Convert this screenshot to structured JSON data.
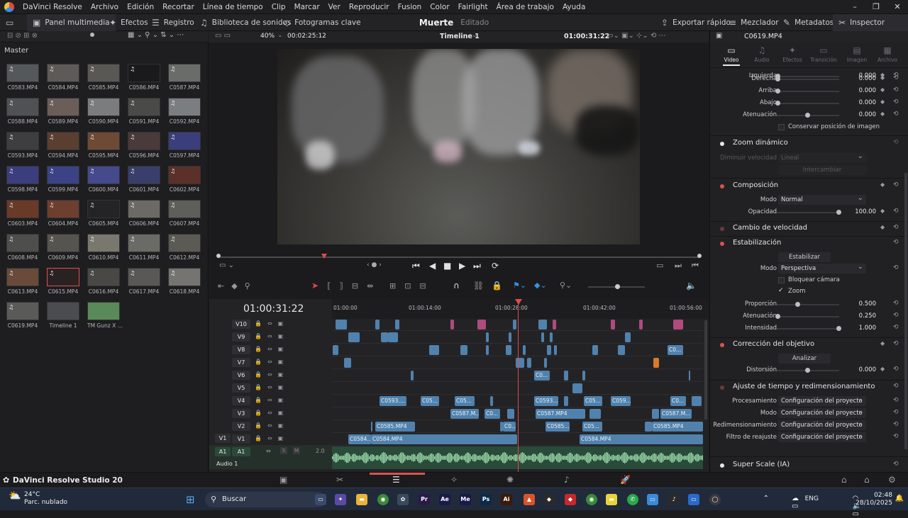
{
  "app": {
    "title": "DaVinci Resolve",
    "menus": [
      "Archivo",
      "Edición",
      "Recortar",
      "Línea de tiempo",
      "Clip",
      "Marcar",
      "Ver",
      "Reproducir",
      "Fusion",
      "Color",
      "Fairlight",
      "Área de trabajo",
      "Ayuda"
    ]
  },
  "toolbar": {
    "media_pool": "Panel multimedia",
    "effects": "Efectos",
    "index": "Registro",
    "sound_library": "Biblioteca de sonidos",
    "keyframes": "Fotogramas clave",
    "project_name": "Muerte",
    "project_status": "Editado",
    "quick_export": "Exportar rápido",
    "mixer": "Mezclador",
    "metadata": "Metadatos",
    "inspector": "Inspector"
  },
  "pool": {
    "folder": "Master",
    "clips": [
      {
        "name": "C0583.MP4",
        "color": "#55585a"
      },
      {
        "name": "C0584.MP4",
        "color": "#5d5a58"
      },
      {
        "name": "C0585.MP4",
        "color": "#5a5855"
      },
      {
        "name": "C0586.MP4",
        "color": "#1a1a1c"
      },
      {
        "name": "C0587.MP4",
        "color": "#6a6c6a"
      },
      {
        "name": "C0588.MP4",
        "color": "#4f5155"
      },
      {
        "name": "C0589.MP4",
        "color": "#6b5e58"
      },
      {
        "name": "C0590.MP4",
        "color": "#7a7c7e"
      },
      {
        "name": "C0591.MP4",
        "color": "#4a4a48"
      },
      {
        "name": "C0592.MP4",
        "color": "#7b7e80"
      },
      {
        "name": "C0593.MP4",
        "color": "#3e3e40"
      },
      {
        "name": "C0594.MP4",
        "color": "#5a3e30"
      },
      {
        "name": "C0595.MP4",
        "color": "#6e4a36"
      },
      {
        "name": "C0596.MP4",
        "color": "#4a3a3a"
      },
      {
        "name": "C0597.MP4",
        "color": "#3a3e7a"
      },
      {
        "name": "C0598.MP4",
        "color": "#3a3e7e"
      },
      {
        "name": "C0599.MP4",
        "color": "#3c4286"
      },
      {
        "name": "C0600.MP4",
        "color": "#444a8c"
      },
      {
        "name": "C0601.MP4",
        "color": "#3a3e6c"
      },
      {
        "name": "C0602.MP4",
        "color": "#5a3028"
      },
      {
        "name": "C0603.MP4",
        "color": "#6a3a28"
      },
      {
        "name": "C0604.MP4",
        "color": "#6e3e2e"
      },
      {
        "name": "C0605.MP4",
        "color": "#242426"
      },
      {
        "name": "C0606.MP4",
        "color": "#6c6a64"
      },
      {
        "name": "C0607.MP4",
        "color": "#5e5e5a"
      },
      {
        "name": "C0608.MP4",
        "color": "#4e4e4c"
      },
      {
        "name": "C0609.MP4",
        "color": "#56544e"
      },
      {
        "name": "C0610.MP4",
        "color": "#7a786e"
      },
      {
        "name": "C0611.MP4",
        "color": "#6a6a66"
      },
      {
        "name": "C0612.MP4",
        "color": "#5c5a54"
      },
      {
        "name": "C0613.MP4",
        "color": "#6a4a3a"
      },
      {
        "name": "C0615.MP4",
        "color": "#2a2222",
        "selected": true
      },
      {
        "name": "C0616.MP4",
        "color": "#4a4844"
      },
      {
        "name": "C0617.MP4",
        "color": "#5a5856"
      },
      {
        "name": "C0618.MP4",
        "color": "#767470"
      },
      {
        "name": "C0619.MP4",
        "color": "#5a5a58"
      },
      {
        "name": "Timeline 1",
        "color": "#4a4c50"
      },
      {
        "name": "TM Gunz X ...",
        "color": "#5a8a5a"
      }
    ]
  },
  "viewer": {
    "zoom": "40%",
    "source_tc": "00:02:25:12",
    "timeline_name": "Timeline 1",
    "record_tc": "01:00:31:22",
    "scrub_fraction": 0.22
  },
  "timeline": {
    "timecode": "01:00:31:22",
    "ruler": [
      "01:00:00",
      "01:00:14:00",
      "01:00:28:00",
      "01:00:42:00",
      "01:00:56:00"
    ],
    "video_tracks": [
      "V10",
      "V9",
      "V8",
      "V7",
      "V6",
      "V5",
      "V4",
      "V3",
      "V2",
      "V1"
    ],
    "patch_video": "V1",
    "audio_track": "A1",
    "patch_audio": "A1",
    "audio_channels": "2.0",
    "audio_name": "Audio 1",
    "audio_solo": "S",
    "audio_mute": "M",
    "clip_labels": {
      "v8": "C0...",
      "v6": "C0...",
      "v4a": "C0593....",
      "v4b": "C05...",
      "v4c": "C05...",
      "v4d": "C0593....",
      "v4e": "C05...",
      "v4f": "C059...",
      "v4g": "C0...",
      "v3a": "C0587.M...",
      "v3b": "C0...",
      "v3c": "C0587.MP4",
      "v3d": "C0587.M...",
      "v2a": "C0585.MP4",
      "v2b": "C0...",
      "v2c": "C0585....",
      "v2d": "C05...",
      "v2e": "C0585.MP4",
      "v1a": "C0584....",
      "v1b": "C0584.MP4",
      "v1c": "C0584.MP4"
    }
  },
  "inspector": {
    "clip_name": "C0619.MP4",
    "tabs": [
      "Video",
      "Audio",
      "Efectos",
      "Transición",
      "Imagen",
      "Archivo"
    ],
    "active_tab": "Video",
    "cropping": {
      "cut_label": "Izquierda",
      "left_value": "0.000",
      "right_label": "Derecha",
      "right_value": "0.000",
      "top_label": "Arriba",
      "top_value": "0.000",
      "bottom_label": "Abajo",
      "bottom_value": "0.000",
      "softness_label": "Atenuación",
      "softness_value": "0.000",
      "retain_label": "Conservar posición de imagen"
    },
    "dynamic_zoom": {
      "title": "Zoom dinámico",
      "ease_label": "Diminuir velocidad",
      "ease_value": "Lineal",
      "swap_label": "Intercambiar"
    },
    "composite": {
      "title": "Composición",
      "mode_label": "Modo",
      "mode_value": "Normal",
      "opacity_label": "Opacidad",
      "opacity_value": "100.00"
    },
    "speed_change": {
      "title": "Cambio de velocidad"
    },
    "stabilization": {
      "title": "Estabilización",
      "button": "Estabilizar",
      "mode_label": "Modo",
      "mode_value": "Perspectiva",
      "camera_lock": "Bloquear cámara",
      "zoom": "Zoom",
      "zoom_check": "✓",
      "cropping_ratio_label": "Proporción",
      "cropping_ratio_value": "0.500",
      "smooth_label": "Atenuación",
      "smooth_value": "0.250",
      "strength_label": "Intensidad",
      "strength_value": "1.000"
    },
    "lens_correction": {
      "title": "Corrección del objetivo",
      "button": "Analizar",
      "distortion_label": "Distorsión",
      "distortion_value": "0.000"
    },
    "retime": {
      "title": "Ajuste de tiempo y redimensionamiento",
      "process_label": "Procesamiento",
      "process_value": "Configuración del proyecto",
      "motion_label": "Modo",
      "motion_value": "Configuración del proyecto",
      "scaling_label": "Redimensionamiento",
      "scaling_value": "Configuración del proyecto",
      "filter_label": "Filtro de reajuste",
      "filter_value": "Configuración del proyecto"
    },
    "super_scale": {
      "title": "Super Scale (IA)"
    }
  },
  "pagebar": {
    "brand": "DaVinci Resolve Studio 20"
  },
  "taskbar": {
    "temp": "24°C",
    "weather": "Parc. nublado",
    "search": "Buscar",
    "lang": "ENG",
    "time": "02:48",
    "date": "28/10/2025",
    "apps": [
      {
        "label": "Pr",
        "color": "#2a1a4a"
      },
      {
        "label": "Ae",
        "color": "#1a1a4a"
      },
      {
        "label": "Me",
        "color": "#1a1a4a"
      },
      {
        "label": "Ps",
        "color": "#0a2a4a"
      },
      {
        "label": "Ai",
        "color": "#3a1a0a"
      }
    ]
  }
}
